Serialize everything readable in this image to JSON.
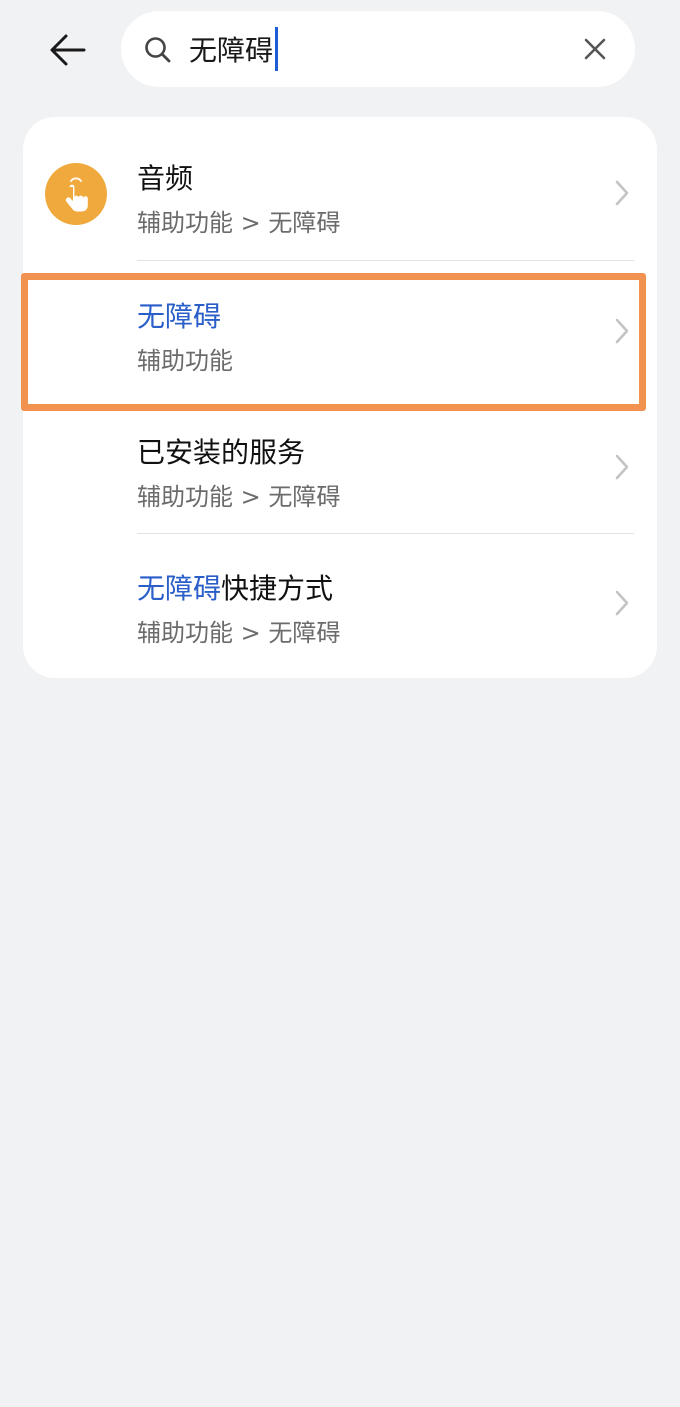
{
  "header": {
    "back_icon": "back-arrow-icon",
    "search": {
      "value": "无障碍",
      "icon": "search-icon",
      "clear_icon": "close-icon"
    }
  },
  "results": [
    {
      "title_plain": "音频",
      "title_highlight": "",
      "title_suffix": "",
      "subtitle": "辅助功能 > 无障碍",
      "icon": "accessibility-touch-icon",
      "icon_color": "#f0a93c"
    },
    {
      "title_plain": "",
      "title_highlight": "无障碍",
      "title_suffix": "",
      "subtitle": "辅助功能",
      "icon": ""
    },
    {
      "title_plain": "已安装的服务",
      "title_highlight": "",
      "title_suffix": "",
      "subtitle": "辅助功能 > 无障碍",
      "icon": ""
    },
    {
      "title_plain": "",
      "title_highlight": "无障碍",
      "title_suffix": "快捷方式",
      "subtitle": "辅助功能 > 无障碍",
      "icon": ""
    }
  ],
  "colors": {
    "background": "#f1f2f4",
    "highlight_text": "#2a5ec9",
    "annotation_box": "#f29250",
    "caret": "#1f5dd6"
  }
}
